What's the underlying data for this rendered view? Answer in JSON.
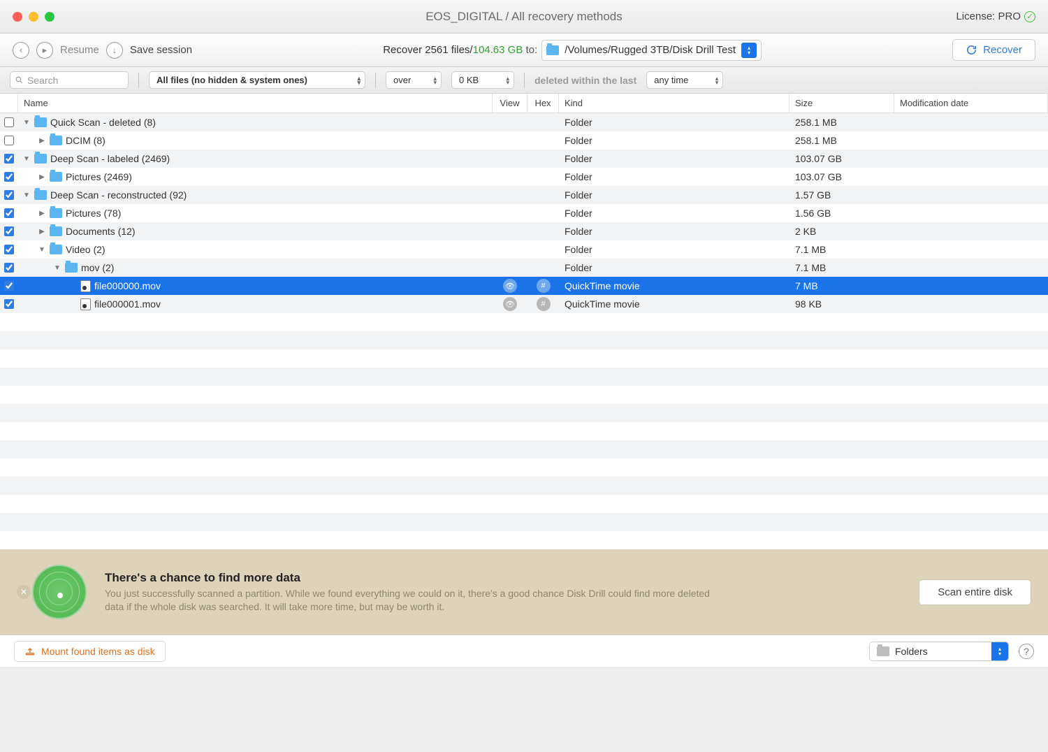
{
  "titlebar": {
    "title": "EOS_DIGITAL / All recovery methods",
    "license_label": "License: PRO"
  },
  "toolbar": {
    "resume": "Resume",
    "save_session": "Save session",
    "recover_prefix": "Recover 2561 files/",
    "recover_size": "104.63 GB",
    "recover_suffix": " to:",
    "path": "/Volumes/Rugged 3TB/Disk Drill Test",
    "recover_btn": "Recover"
  },
  "filters": {
    "search_placeholder": "Search",
    "files_filter": "All files (no hidden & system ones)",
    "size_cond": "over",
    "size_val": "0 KB",
    "time_label": "deleted within the last",
    "time_val": "any time"
  },
  "columns": {
    "name": "Name",
    "view": "View",
    "hex": "Hex",
    "kind": "Kind",
    "size": "Size",
    "mod": "Modification date"
  },
  "rows": [
    {
      "indent": 0,
      "checked": false,
      "expanded": true,
      "icon": "folder",
      "name": "Quick Scan - deleted (8)",
      "kind": "Folder",
      "size": "258.1 MB"
    },
    {
      "indent": 1,
      "checked": false,
      "expanded": false,
      "icon": "folder",
      "name": "DCIM (8)",
      "kind": "Folder",
      "size": "258.1 MB"
    },
    {
      "indent": 0,
      "checked": true,
      "expanded": true,
      "icon": "folder",
      "name": "Deep Scan - labeled (2469)",
      "kind": "Folder",
      "size": "103.07 GB"
    },
    {
      "indent": 1,
      "checked": true,
      "expanded": false,
      "icon": "folder",
      "name": "Pictures (2469)",
      "kind": "Folder",
      "size": "103.07 GB"
    },
    {
      "indent": 0,
      "checked": true,
      "expanded": true,
      "icon": "folder",
      "name": "Deep Scan - reconstructed (92)",
      "kind": "Folder",
      "size": "1.57 GB"
    },
    {
      "indent": 1,
      "checked": true,
      "expanded": false,
      "icon": "folder",
      "name": "Pictures (78)",
      "kind": "Folder",
      "size": "1.56 GB"
    },
    {
      "indent": 1,
      "checked": true,
      "expanded": false,
      "icon": "folder",
      "name": "Documents (12)",
      "kind": "Folder",
      "size": "2 KB"
    },
    {
      "indent": 1,
      "checked": true,
      "expanded": true,
      "icon": "folder",
      "name": "Video (2)",
      "kind": "Folder",
      "size": "7.1 MB"
    },
    {
      "indent": 2,
      "checked": true,
      "expanded": true,
      "icon": "folder",
      "name": "mov (2)",
      "kind": "Folder",
      "size": "7.1 MB"
    },
    {
      "indent": 3,
      "checked": true,
      "expanded": null,
      "icon": "file",
      "name": "file000000.mov",
      "kind": "QuickTime movie",
      "size": "7 MB",
      "selected": true,
      "has_view": true
    },
    {
      "indent": 3,
      "checked": true,
      "expanded": null,
      "icon": "file",
      "name": "file000001.mov",
      "kind": "QuickTime movie",
      "size": "98 KB",
      "has_view": true
    }
  ],
  "banner": {
    "title": "There's a chance to find more data",
    "body": "You just successfully scanned a partition. While we found everything we could on it, there's a good chance Disk Drill could find more deleted data if the whole disk was searched. It will take more time, but may be worth it.",
    "button": "Scan entire disk"
  },
  "bottom": {
    "mount": "Mount found items as disk",
    "viewmode": "Folders"
  }
}
